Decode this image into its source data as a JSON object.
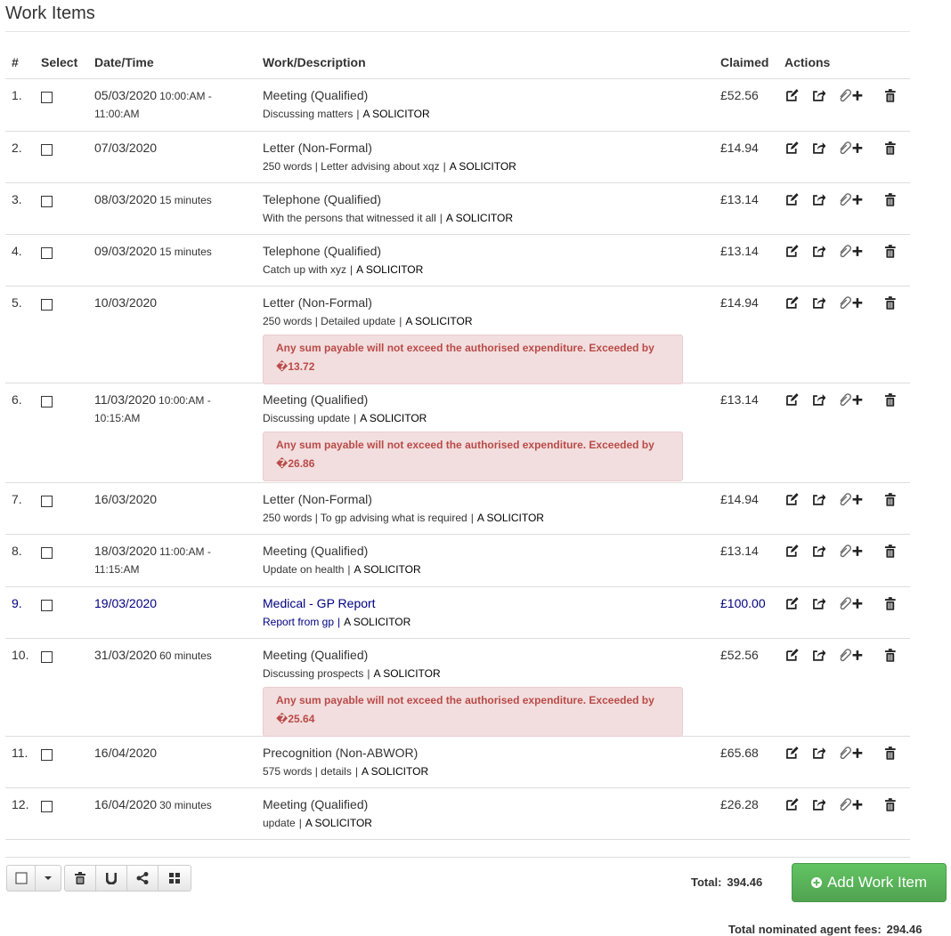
{
  "page": {
    "title": "Work Items"
  },
  "table": {
    "headers": {
      "num": "#",
      "select": "Select",
      "date": "Date/Time",
      "work": "Work/Description",
      "claimed": "Claimed",
      "actions": "Actions"
    },
    "rows": [
      {
        "num": "1.",
        "date": "05/03/2020",
        "dur": "10:00:AM -",
        "date2": "11:00:AM",
        "title": "Meeting (Qualified)",
        "desc": "Discussing matters",
        "who": "A SOLICITOR",
        "claimed": "£52.56",
        "alert": ""
      },
      {
        "num": "2.",
        "date": "07/03/2020",
        "dur": "",
        "date2": "",
        "title": "Letter (Non-Formal)",
        "desc": "250 words | Letter advising about xqz",
        "who": "A SOLICITOR",
        "claimed": "£14.94",
        "alert": ""
      },
      {
        "num": "3.",
        "date": "08/03/2020",
        "dur": "15 minutes",
        "date2": "",
        "title": "Telephone (Qualified)",
        "desc": "With the persons that witnessed it all",
        "who": "A SOLICITOR",
        "claimed": "£13.14",
        "alert": ""
      },
      {
        "num": "4.",
        "date": "09/03/2020",
        "dur": "15 minutes",
        "date2": "",
        "title": "Telephone (Qualified)",
        "desc": "Catch up with xyz",
        "who": "A SOLICITOR",
        "claimed": "£13.14",
        "alert": ""
      },
      {
        "num": "5.",
        "date": "10/03/2020",
        "dur": "",
        "date2": "",
        "title": "Letter (Non-Formal)",
        "desc": "250 words | Detailed update",
        "who": "A SOLICITOR",
        "claimed": "£14.94",
        "alert": "Any sum payable will not exceed the authorised expenditure. Exceeded by �13.72"
      },
      {
        "num": "6.",
        "date": "11/03/2020",
        "dur": "10:00:AM -",
        "date2": "10:15:AM",
        "title": "Meeting (Qualified)",
        "desc": "Discussing update",
        "who": "A SOLICITOR",
        "claimed": "£13.14",
        "alert": "Any sum payable will not exceed the authorised expenditure. Exceeded by �26.86"
      },
      {
        "num": "7.",
        "date": "16/03/2020",
        "dur": "",
        "date2": "",
        "title": "Letter (Non-Formal)",
        "desc": "250 words | To gp advising what is required",
        "who": "A SOLICITOR",
        "claimed": "£14.94",
        "alert": ""
      },
      {
        "num": "8.",
        "date": "18/03/2020",
        "dur": "11:00:AM -",
        "date2": "11:15:AM",
        "title": "Meeting (Qualified)",
        "desc": "Update on health",
        "who": "A SOLICITOR",
        "claimed": "£13.14",
        "alert": ""
      },
      {
        "num": "9.",
        "date": "19/03/2020",
        "dur": "",
        "date2": "",
        "title": "Medical - GP Report",
        "desc": "Report from gp",
        "who": "A SOLICITOR",
        "claimed": "£100.00",
        "alert": ""
      },
      {
        "num": "10.",
        "date": "31/03/2020",
        "dur": "60 minutes",
        "date2": "",
        "title": "Meeting (Qualified)",
        "desc": "Discussing prospects",
        "who": "A SOLICITOR",
        "claimed": "£52.56",
        "alert": "Any sum payable will not exceed the authorised expenditure. Exceeded by �25.64"
      },
      {
        "num": "11.",
        "date": "16/04/2020",
        "dur": "",
        "date2": "",
        "title": "Precognition (Non-ABWOR)",
        "desc": "575 words | details",
        "who": "A SOLICITOR",
        "claimed": "£65.68",
        "alert": ""
      },
      {
        "num": "12.",
        "date": "16/04/2020",
        "dur": "30 minutes",
        "date2": "",
        "title": "Meeting (Qualified)",
        "desc": "update",
        "who": "A SOLICITOR",
        "claimed": "£26.28",
        "alert": ""
      }
    ]
  },
  "footer": {
    "total_label": "Total:",
    "total_value": "394.46",
    "add_button": "Add Work Item",
    "agent_label": "Total nominated agent fees:",
    "agent_value": "294.46"
  },
  "colors": {
    "link_row": "#000080",
    "alert_bg": "#f2dede",
    "alert_text": "#b94a48",
    "add_button": "#5cb85c"
  }
}
